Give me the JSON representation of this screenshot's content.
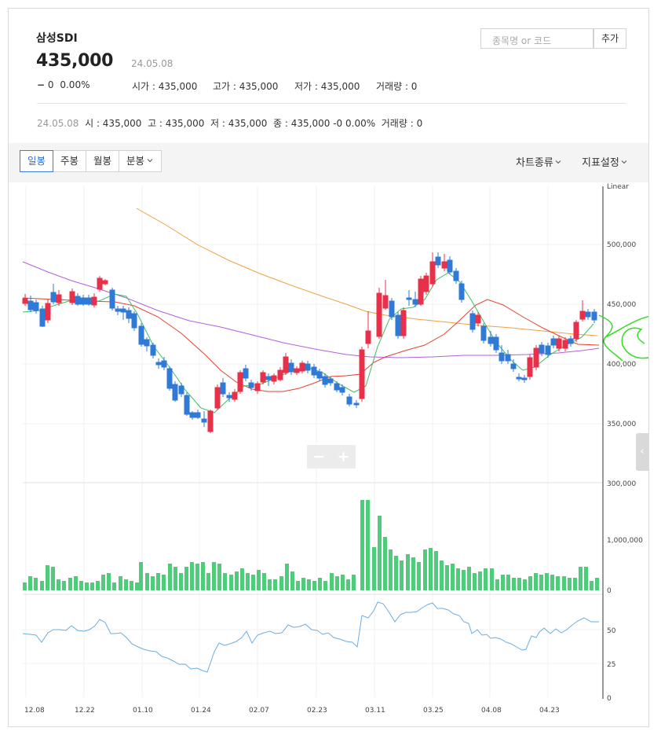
{
  "stock": {
    "name": "삼성SDI",
    "price": "435,000",
    "date": "24.05.08",
    "change": "0",
    "change_pct": "0.00%",
    "open_label": "시가",
    "open": "435,000",
    "high_label": "고가",
    "high": "435,000",
    "low_label": "저가",
    "low": "435,000",
    "volume_label": "거래량",
    "volume": "0"
  },
  "search": {
    "placeholder": "종목명 or 코드",
    "add_label": "추가"
  },
  "summary_line": {
    "date": "24.05.08",
    "o_label": "시",
    "o": "435,000",
    "h_label": "고",
    "h": "435,000",
    "l_label": "저",
    "l": "435,000",
    "c_label": "종",
    "c": "435,000",
    "diff": "-0",
    "pct": "0.00%",
    "vol_label": "거래량",
    "vol": "0"
  },
  "toolbar": {
    "tabs": [
      "일봉",
      "주봉",
      "월봉",
      "분봉"
    ],
    "active_tab": "일봉",
    "chart_type_label": "차트종류",
    "indicator_label": "지표설정"
  },
  "colors": {
    "up": "#e8304a",
    "down": "#2f7ad6",
    "volume": "#4dcc7a",
    "ma5": "#3fbf5f",
    "ma20": "#e5412f",
    "ma60": "#b060e0",
    "ma120": "#f0a040",
    "rsi": "#6aaee0",
    "annotation": "#33dd22",
    "active_tab": "#2f6fd6"
  },
  "chart_data": {
    "type": "candlestick",
    "scale_label": "Linear",
    "price_axis": {
      "ticks": [
        "500,000",
        "450,000",
        "400,000",
        "350,000",
        "300,000"
      ],
      "range": [
        300000,
        530000
      ]
    },
    "volume_axis": {
      "ticks": [
        "1,000,000",
        "0"
      ],
      "range": [
        0,
        1900000
      ]
    },
    "rsi_axis": {
      "ticks": [
        "50",
        "25",
        "0"
      ],
      "range": [
        0,
        75
      ]
    },
    "x_ticks": [
      "12.08",
      "12.22",
      "01.10",
      "01.24",
      "02.07",
      "02.23",
      "03.11",
      "03.25",
      "04.08",
      "04.23"
    ],
    "moving_averages": [
      "MA5",
      "MA20",
      "MA60",
      "MA120"
    ],
    "last_close": 435000,
    "period": [
      "2023-12-08",
      "2024-05-08"
    ]
  },
  "zoom": {
    "minus": "−",
    "plus": "+"
  },
  "side_handle": {
    "icon": "‹"
  }
}
